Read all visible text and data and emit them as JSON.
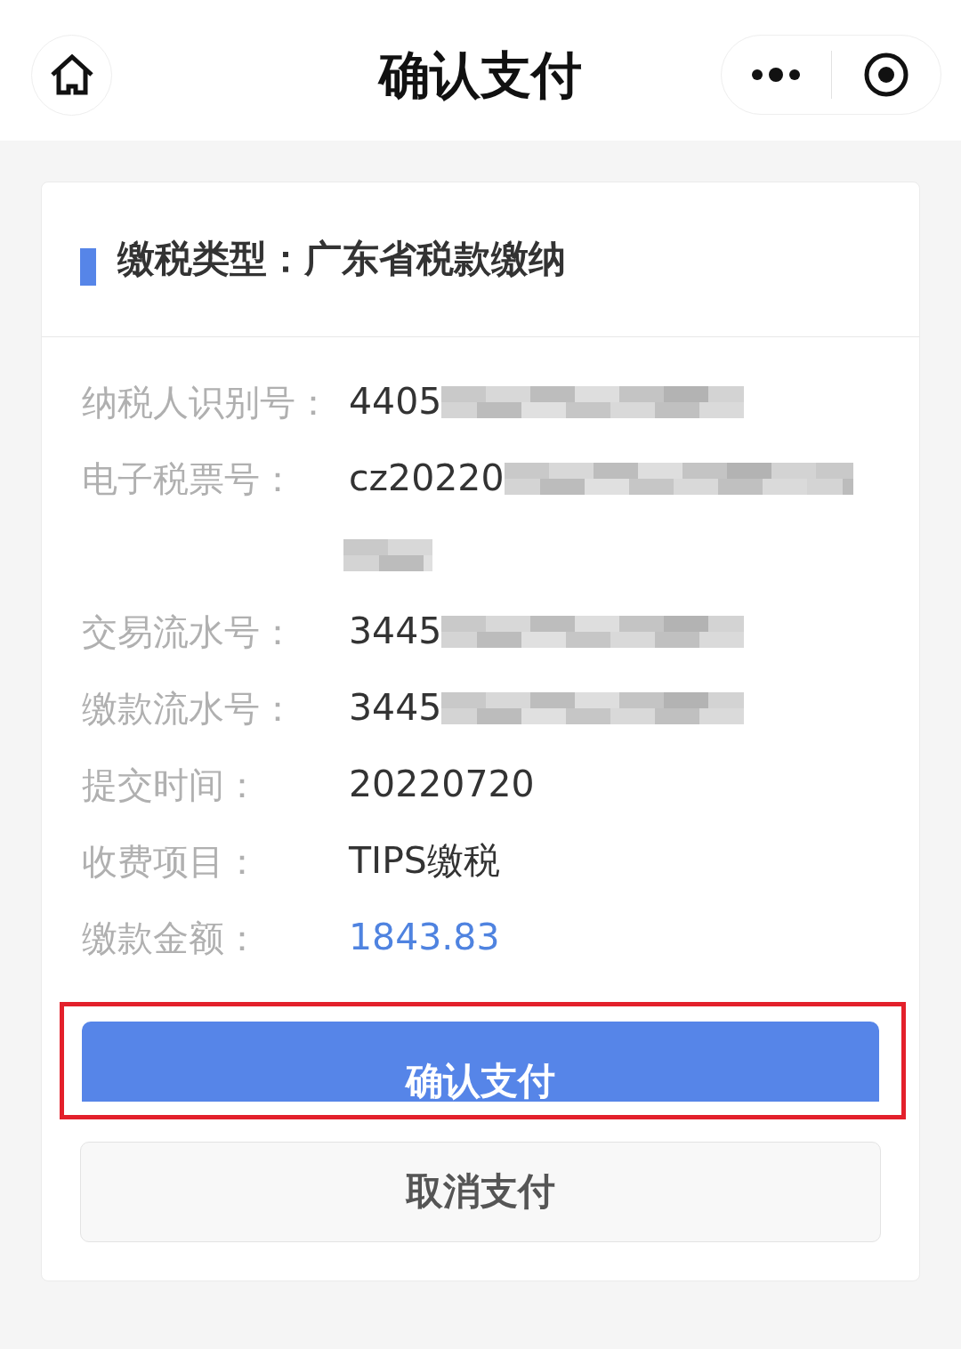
{
  "nav_bar": {
    "title": "确认支付"
  },
  "card": {
    "heading": "缴税类型：广东省税款缴纳",
    "rows": [
      {
        "label": "纳税人识别号：",
        "value": "4405",
        "redacted": true,
        "redaction_wraps": false,
        "emphasis": false
      },
      {
        "label": "电子税票号：",
        "value": "cz20220",
        "redacted": true,
        "redaction_wraps": true,
        "emphasis": false
      },
      {
        "label": "交易流水号：",
        "value": "3445",
        "redacted": true,
        "redaction_wraps": false,
        "emphasis": false
      },
      {
        "label": "缴款流水号：",
        "value": "3445",
        "redacted": true,
        "redaction_wraps": false,
        "emphasis": false
      },
      {
        "label": "提交时间：",
        "value": "20220720",
        "redacted": false,
        "redaction_wraps": false,
        "emphasis": false
      },
      {
        "label": "收费项目：",
        "value": "TIPS缴税",
        "redacted": false,
        "redaction_wraps": false,
        "emphasis": false
      },
      {
        "label": "缴款金额：",
        "value": "1843.83",
        "redacted": false,
        "redaction_wraps": false,
        "emphasis": true
      }
    ],
    "buttons": [
      {
        "label": "确认支付",
        "kind": "primary",
        "annotated": true
      },
      {
        "label": "取消支付",
        "kind": "secondary",
        "annotated": false
      }
    ]
  }
}
